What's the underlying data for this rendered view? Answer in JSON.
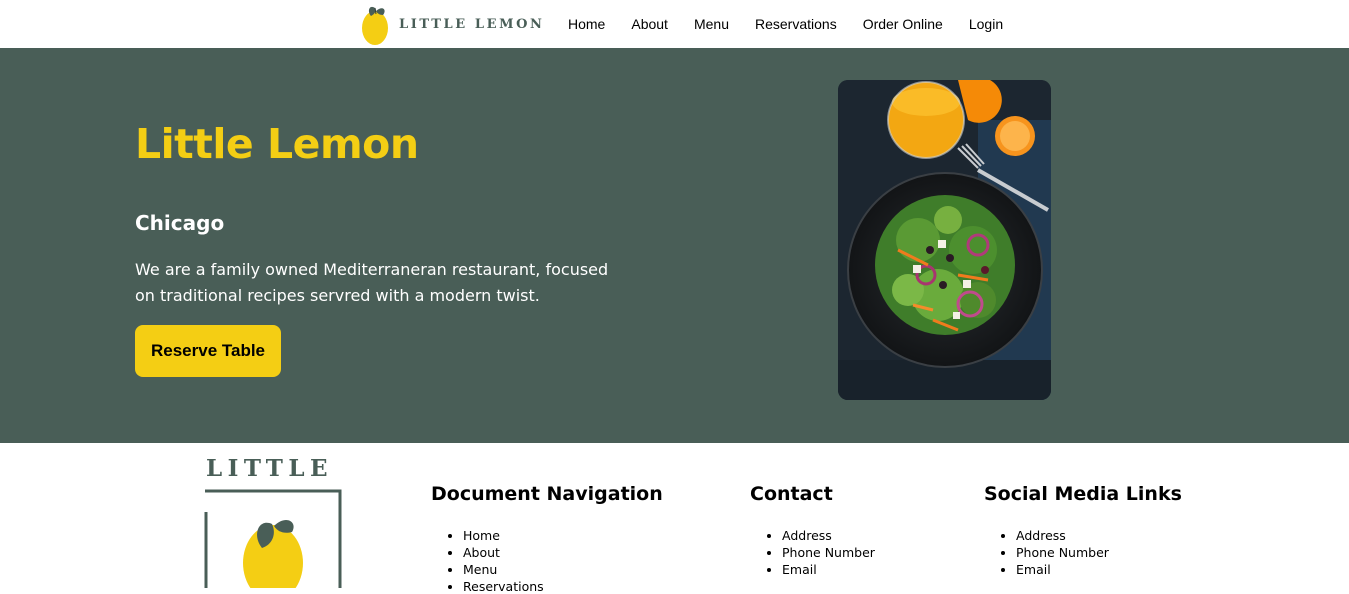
{
  "nav": {
    "logo_text": "LITTLE LEMON",
    "links": [
      "Home",
      "About",
      "Menu",
      "Reservations",
      "Order Online",
      "Login"
    ]
  },
  "hero": {
    "title": "Little Lemon",
    "city": "Chicago",
    "description": "We are a family owned Mediterraneran restaurant, focused on traditional recipes servred with a modern twist.",
    "button_label": "Reserve Table"
  },
  "footer": {
    "logo_text": "LITTLE",
    "columns": [
      {
        "heading": "Document Navigation",
        "items": [
          "Home",
          "About",
          "Menu",
          "Reservations"
        ]
      },
      {
        "heading": "Contact",
        "items": [
          "Address",
          "Phone Number",
          "Email"
        ]
      },
      {
        "heading": "Social Media Links",
        "items": [
          "Address",
          "Phone Number",
          "Email"
        ]
      }
    ]
  },
  "colors": {
    "primary_green": "#495e57",
    "primary_yellow": "#f4ce14",
    "white": "#ffffff"
  }
}
